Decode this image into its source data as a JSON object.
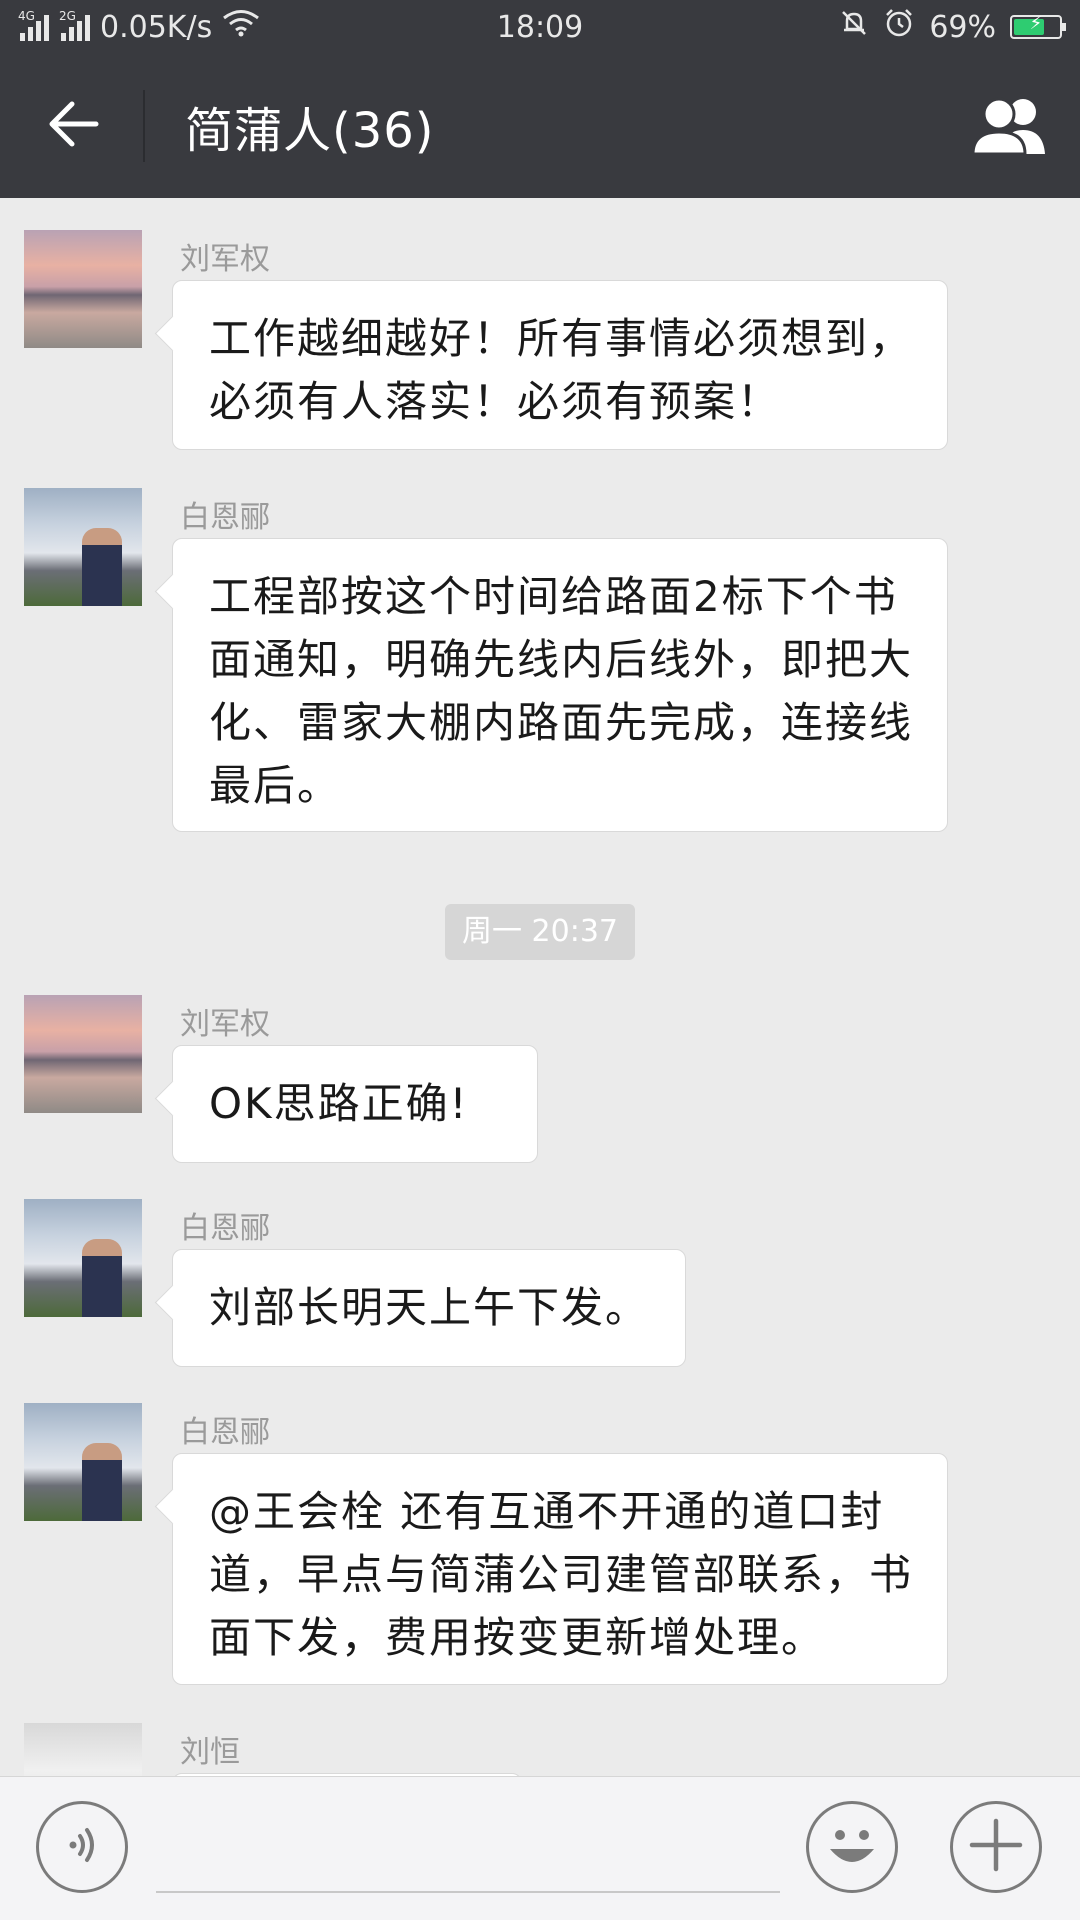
{
  "status_bar": {
    "net_label_1": "4G",
    "net_label_2": "2G",
    "speed": "0.05K/s",
    "time": "18:09",
    "battery": "69%",
    "battery_level": 0.69,
    "icons": [
      "signal-icon",
      "signal-icon",
      "wifi-icon",
      "mute-bell-icon",
      "alarm-icon",
      "battery-icon"
    ]
  },
  "header": {
    "title": "简蒲人(36)",
    "back_icon": "arrow-left-icon",
    "group_icon": "group-members-icon"
  },
  "messages": [
    {
      "sender": "刘军权",
      "avatar": "lake-sunset-avatar",
      "text": "工作越细越好！所有事情必须想到，必须有人落实！必须有预案！"
    },
    {
      "sender": "白恩郦",
      "avatar": "cliff-man-avatar",
      "text": "工程部按这个时间给路面2标下个书面通知，明确先线内后线外，即把大化、雷家大棚内路面先完成，连接线最后。"
    },
    {
      "sender": "刘军权",
      "avatar": "lake-sunset-avatar",
      "text": "OK思路正确!"
    },
    {
      "sender": "白恩郦",
      "avatar": "cliff-man-avatar",
      "text": "刘部长明天上午下发。"
    },
    {
      "sender": "白恩郦",
      "avatar": "cliff-man-avatar",
      "text": "@王会栓 还有互通不开通的道口封道，早点与简蒲公司建管部联系，书面下发，费用按变更新增处理。"
    },
    {
      "sender": "刘恒",
      "avatar": "pink-item-avatar",
      "text": ""
    }
  ],
  "time_separator": "周一 20:37",
  "input_bar": {
    "placeholder": "",
    "voice_icon": "voice-icon",
    "emoji_icon": "emoji-icon",
    "plus_icon": "plus-icon"
  },
  "colors": {
    "header_bg": "#393a3f",
    "chat_bg": "#ebebeb",
    "bubble_bg": "#ffffff",
    "battery_fill": "#2ecc71"
  }
}
